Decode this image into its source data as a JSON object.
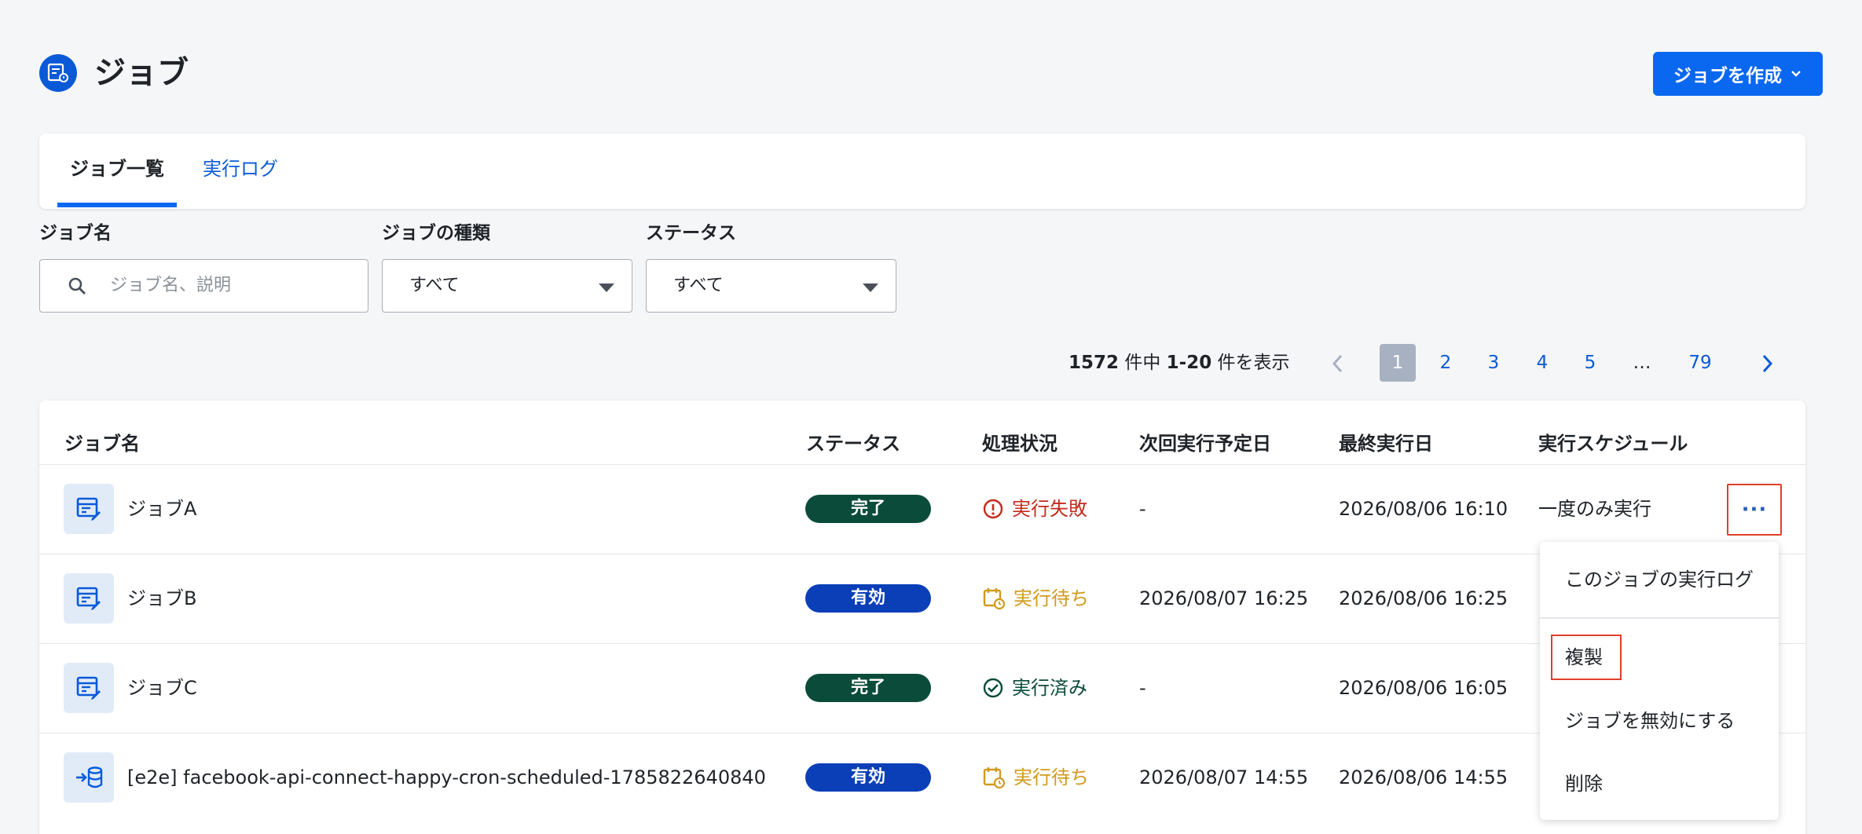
{
  "header": {
    "title": "ジョブ",
    "create_button": "ジョブを作成",
    "accent": "#0a68f0"
  },
  "tabs": [
    {
      "label": "ジョブ一覧",
      "active": true
    },
    {
      "label": "実行ログ",
      "active": false
    }
  ],
  "filters": {
    "job_name": {
      "label": "ジョブ名",
      "placeholder": "ジョブ名、説明"
    },
    "job_type": {
      "label": "ジョブの種類",
      "value": "すべて"
    },
    "status": {
      "label": "ステータス",
      "value": "すべて"
    }
  },
  "pagination": {
    "total": "1572",
    "range_mid": "件中",
    "range": "1-20",
    "range_suffix": "件を表示",
    "pages": [
      "1",
      "2",
      "3",
      "4",
      "5",
      "…",
      "79"
    ],
    "current": "1"
  },
  "table": {
    "headers": [
      "ジョブ名",
      "ステータス",
      "処理状況",
      "次回実行予定日",
      "最終実行日",
      "実行スケジュール"
    ],
    "rows": [
      {
        "name": "ジョブA",
        "icon": "table-edit-icon",
        "status": "完了",
        "status_color": "#0b4b39",
        "process": "実行失敗",
        "process_icon": "alert-circle-icon",
        "process_color": "#c42a1c",
        "next_run": "-",
        "last_run": "2026/08/06 16:10",
        "schedule": "一度のみ実行"
      },
      {
        "name": "ジョブB",
        "icon": "table-edit-icon",
        "status": "有効",
        "status_color": "#0a3fb8",
        "process": "実行待ち",
        "process_icon": "calendar-clock-icon",
        "process_color": "#d19a1c",
        "next_run": "2026/08/07 16:25",
        "last_run": "2026/08/06 16:25",
        "schedule": ""
      },
      {
        "name": "ジョブC",
        "icon": "table-edit-icon",
        "status": "完了",
        "status_color": "#0b4b39",
        "process": "実行済み",
        "process_icon": "check-circle-icon",
        "process_color": "#0b4b39",
        "next_run": "-",
        "last_run": "2026/08/06 16:05",
        "schedule": ""
      },
      {
        "name": "[e2e] facebook-api-connect-happy-cron-scheduled-1785822640840",
        "icon": "database-import-icon",
        "status": "有効",
        "status_color": "#0a3fb8",
        "process": "実行待ち",
        "process_icon": "calendar-clock-icon",
        "process_color": "#d19a1c",
        "next_run": "2026/08/07 14:55",
        "last_run": "2026/08/06 14:55",
        "schedule": ""
      }
    ]
  },
  "row_menu": {
    "more_label": "···",
    "items": [
      "このジョブの実行ログ",
      "複製",
      "ジョブを無効にする",
      "削除"
    ]
  }
}
